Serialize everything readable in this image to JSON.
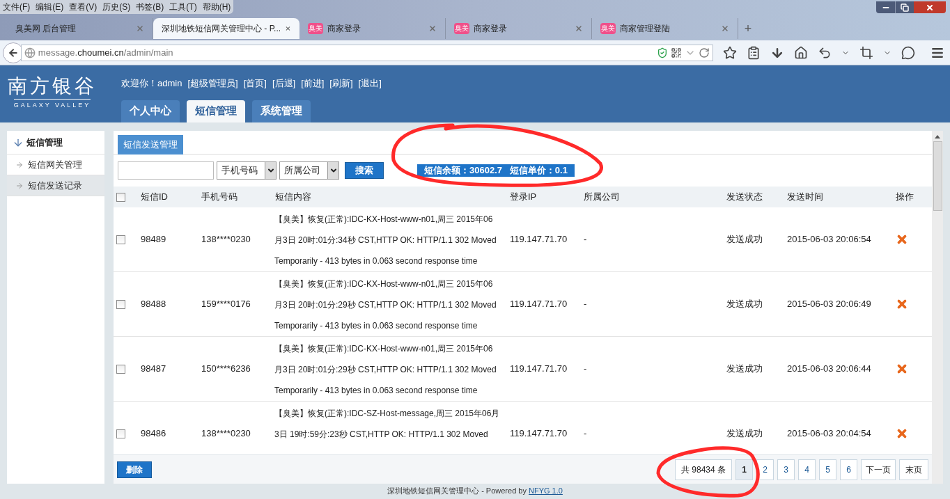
{
  "browser": {
    "menu": [
      "文件(F)",
      "编辑(E)",
      "查看(V)",
      "历史(S)",
      "书签(B)",
      "工具(T)",
      "帮助(H)"
    ],
    "tabs": [
      {
        "title": "臭美网 后台管理",
        "selected": false
      },
      {
        "title": "深圳地铁短信网关管理中心 - P...",
        "selected": true
      },
      {
        "title": "商家登录",
        "selected": false,
        "favicon": "臭美"
      },
      {
        "title": "商家登录",
        "selected": false,
        "favicon": "臭美"
      },
      {
        "title": "商家管理登陆",
        "selected": false,
        "favicon": "臭美"
      }
    ],
    "new_tab": "+",
    "url": {
      "prefix": "message.",
      "domain": "choumei.cn",
      "path": "/admin/main"
    }
  },
  "header": {
    "logo_title": "南方银谷",
    "logo_subtitle": "GALAXY VALLEY",
    "greeting": "欢迎你！admin",
    "links": [
      "[超级管理员]",
      "[首页]",
      "[后退]",
      "[前进]",
      "[刷新]",
      "[退出]"
    ],
    "nav_tabs": [
      {
        "label": "个人中心",
        "selected": false
      },
      {
        "label": "短信管理",
        "selected": true
      },
      {
        "label": "系统管理",
        "selected": false
      }
    ]
  },
  "sidebar": {
    "heading": "短信管理",
    "items": [
      {
        "label": "短信网关管理",
        "selected": false
      },
      {
        "label": "短信发送记录",
        "selected": true
      }
    ]
  },
  "content": {
    "section_tab": "短信发送管理",
    "selects": [
      "手机号码",
      "所属公司"
    ],
    "search_button": "搜索",
    "balance": "短信余额：30602.7   短信单价：0.1",
    "table": {
      "select_all": {
        "checked": false
      },
      "columns": [
        "短信ID",
        "手机号码",
        "短信内容",
        "登录IP",
        "所属公司",
        "发送状态",
        "发送时间",
        "操作"
      ],
      "rows": [
        {
          "checked": false,
          "id": "98489",
          "phone": "138****0230",
          "content": [
            "【臭美】恢复(正常):IDC-KX-Host-www-n01,周三 2015年06",
            "月3日 20时:01分:34秒 CST,HTTP OK: HTTP/1.1 302 Moved",
            "Temporarily - 413 bytes in 0.063 second response time"
          ],
          "ip": "119.147.71.70",
          "company": "-",
          "status": "发送成功",
          "time": "2015-06-03 20:06:54"
        },
        {
          "checked": false,
          "id": "98488",
          "phone": "159****0176",
          "content": [
            "【臭美】恢复(正常):IDC-KX-Host-www-n01,周三 2015年06",
            "月3日 20时:01分:29秒 CST,HTTP OK: HTTP/1.1 302 Moved",
            "Temporarily - 413 bytes in 0.063 second response time"
          ],
          "ip": "119.147.71.70",
          "company": "-",
          "status": "发送成功",
          "time": "2015-06-03 20:06:49"
        },
        {
          "checked": false,
          "id": "98487",
          "phone": "150****6236",
          "content": [
            "【臭美】恢复(正常):IDC-KX-Host-www-n01,周三 2015年06",
            "月3日 20时:01分:29秒 CST,HTTP OK: HTTP/1.1 302 Moved",
            "Temporarily - 413 bytes in 0.063 second response time"
          ],
          "ip": "119.147.71.70",
          "company": "-",
          "status": "发送成功",
          "time": "2015-06-03 20:06:44"
        },
        {
          "checked": false,
          "id": "98486",
          "phone": "138****0230",
          "content": [
            "【臭美】恢复(正常):IDC-SZ-Host-message,周三 2015年06月",
            "3日 19时:59分:23秒 CST,HTTP OK: HTTP/1.1 302 Moved"
          ],
          "ip": "119.147.71.70",
          "company": "-",
          "status": "发送成功",
          "time": "2015-06-03 20:04:54"
        }
      ]
    },
    "delete_button": "删除",
    "pagination": {
      "total": "共 98434 条",
      "pages": [
        {
          "label": "1",
          "selected": true
        },
        {
          "label": "2",
          "selected": false
        },
        {
          "label": "3",
          "selected": false
        },
        {
          "label": "4",
          "selected": false
        },
        {
          "label": "5",
          "selected": false
        },
        {
          "label": "6",
          "selected": false
        }
      ],
      "next": "下一页",
      "last": "末页"
    }
  },
  "footer": {
    "text": "深圳地铁短信网关管理中心 - Powered by ",
    "link": "NFYG 1.0"
  }
}
